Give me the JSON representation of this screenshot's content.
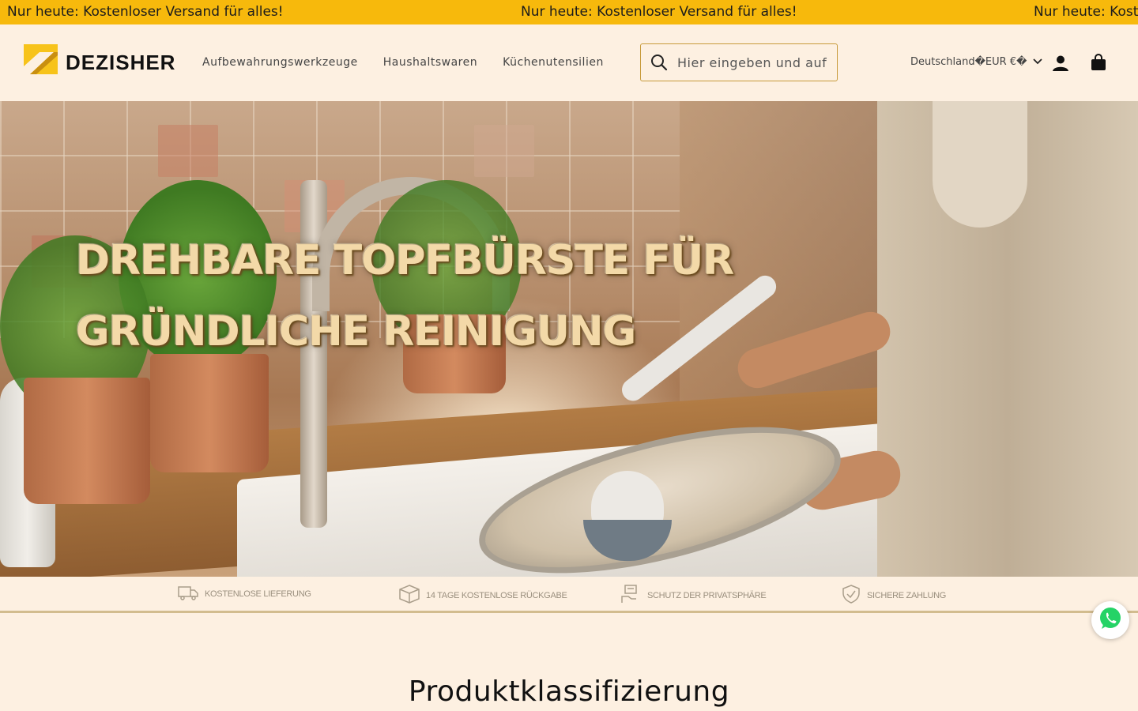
{
  "announcement": {
    "text": "Nur heute: Kostenloser Versand für alles!",
    "text_partial": "Nur heute: Kost"
  },
  "header": {
    "brand": "DEZISHER",
    "nav": [
      {
        "label": "Aufbewahrungswerkzeuge"
      },
      {
        "label": "Haushaltswaren"
      },
      {
        "label": "Küchenutensilien"
      }
    ],
    "search": {
      "placeholder": "Hier eingeben und auf „"
    },
    "locale": "Deutschland�EUR €�",
    "icons": {
      "search": "search-icon",
      "account": "user-icon",
      "cart": "shopping-bag-icon",
      "locale_toggle": "chevron-down-icon"
    }
  },
  "hero": {
    "line1": "DREHBARE TOPFBÜRSTE FÜR",
    "line2": "GRÜNDLICHE REINIGUNG"
  },
  "trust_bar": [
    {
      "icon": "truck-icon",
      "label": "KOSTENLOSE LIEFERUNG"
    },
    {
      "icon": "box-icon",
      "label": "14 TAGE KOSTENLOSE RÜCKGABE"
    },
    {
      "icon": "privacy-icon",
      "label": "SCHUTZ DER PRIVATSPHÄRE"
    },
    {
      "icon": "shield-check-icon",
      "label": "SICHERE ZAHLUNG"
    }
  ],
  "section": {
    "title": "Produktklassifizierung"
  },
  "colors": {
    "announce_bg": "#f7b90c",
    "page_bg": "#fdf0e1",
    "accent": "#c79a3b",
    "whatsapp": "#25d366"
  }
}
